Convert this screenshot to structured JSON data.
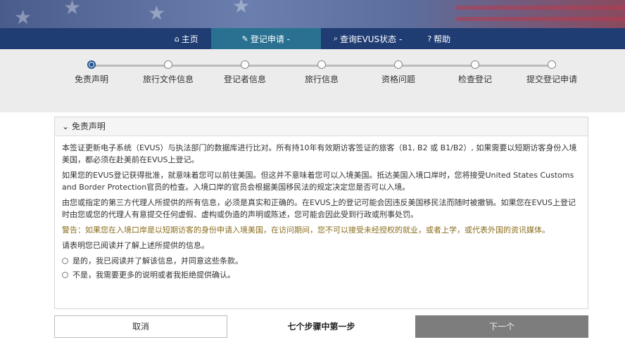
{
  "nav": {
    "items": [
      {
        "label": "主页",
        "icon": "home-icon"
      },
      {
        "label": "登记申请 -",
        "icon": "pencil-icon"
      },
      {
        "label": "查询EVUS状态 -",
        "icon": "search-icon"
      },
      {
        "label": "帮助",
        "icon": "help-icon"
      }
    ]
  },
  "steps": [
    {
      "label": "免责声明"
    },
    {
      "label": "旅行文件信息"
    },
    {
      "label": "登记者信息"
    },
    {
      "label": "旅行信息"
    },
    {
      "label": "资格问题"
    },
    {
      "label": "检查登记"
    },
    {
      "label": "提交登记申请"
    }
  ],
  "panel": {
    "title": "免责声明",
    "p1": "本签证更新电子系统（EVUS）与执法部门的数据库进行比对。所有持10年有效期访客签证的旅客（B1, B2 或 B1/B2）, 如果需要以短期访客身份入境美国，都必须在赴美前在EVUS上登记。",
    "p2": "如果您的EVUS登记获得批准，就意味着您可以前往美国。但这并不意味着您可以入境美国。抵达美国入境口岸时，您将接受United States Customs and Border Protection官员的检查。入境口岸的官员会根据美国移民法的规定决定您是否可以入境。",
    "p3": "由您或指定的第三方代理人所提供的所有信息，必须是真实和正确的。在EVUS上的登记可能会因违反美国移民法而随时被撤销。如果您在EVUS上登记时由您或您的代理人有意提交任何虚假、虚构或伪造的声明或陈述，您可能会因此受到行政或刑事处罚。",
    "warning": "警告：如果您在入境口岸是以短期访客的身份申请入境美国，在访问期间，您不可以接受未经授权的就业，或者上学，或代表外国的资讯媒体。",
    "confirm_prompt": "请表明您已阅读并了解上述所提供的信息。",
    "option_yes": "是的，我已阅读并了解该信息，并同意这些条款。",
    "option_no": "不是，我需要更多的说明或者我拒绝提供确认。"
  },
  "footer": {
    "cancel_label": "取消",
    "step_count": "七个步骤中第一步",
    "next_label": "下一个"
  },
  "colors": {
    "nav_bg": "#1f3d73",
    "nav_active": "#2a7191",
    "next_button": "#7d7d7d",
    "warning_text": "#8a6d1e"
  }
}
